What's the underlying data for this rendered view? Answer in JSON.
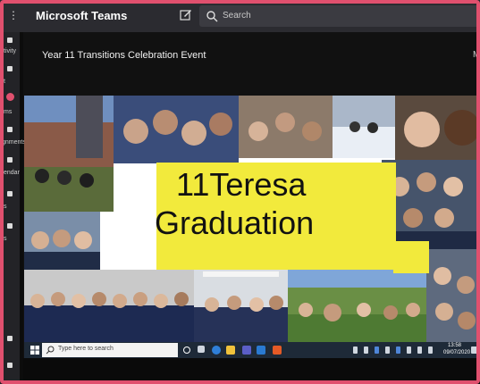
{
  "app": {
    "title": "Microsoft Teams"
  },
  "search": {
    "placeholder": "Search"
  },
  "rail": {
    "items": [
      "tivity",
      "t",
      "ms",
      "gnments",
      "endar",
      "s",
      "s"
    ]
  },
  "meeting": {
    "title": "Year 11 Transitions Celebration Event",
    "more_label": "M"
  },
  "collage": {
    "banner_line1": "11Teresa",
    "banner_line2": "Graduation"
  },
  "taskbar": {
    "search_placeholder": "Type here to search",
    "time": "13:58",
    "date": "09/07/2020"
  },
  "colors": {
    "banner": "#f2ea3c",
    "frame": "#e0506e",
    "teams_bar": "#2b2b30",
    "taskbar": "#1e2a38"
  },
  "icons": [
    "grid-icon",
    "compose-icon",
    "search-icon",
    "windows-logo-icon",
    "cortana-icon",
    "task-view-icon",
    "edge-icon",
    "file-explorer-icon",
    "teams-taskbar-icon",
    "office-icon"
  ]
}
